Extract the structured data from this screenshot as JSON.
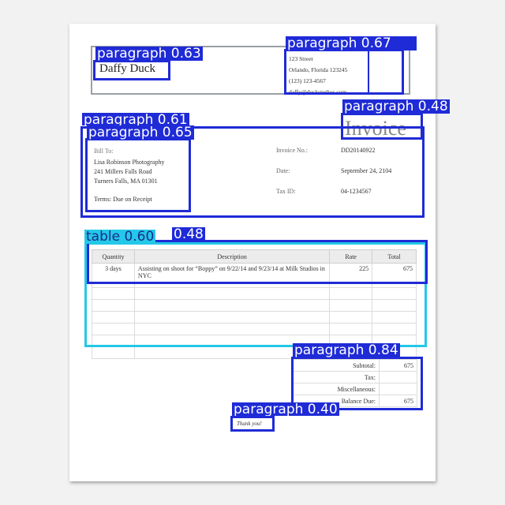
{
  "company": {
    "name": "Daffy Duck"
  },
  "address": {
    "street": "123 Street",
    "city": "Orlando, Florida  123245",
    "phone": "(123) 123-4567",
    "email": "daffy@duckstudios.com"
  },
  "invoice_title": "Invoice",
  "bill_to": {
    "label": "Bill To:",
    "name": "Lisa Robinson Photography",
    "street": "241 Millers Falls Road",
    "city": "Turners Falls, MA  01301",
    "terms": "Terms:  Due on Receipt"
  },
  "meta": [
    {
      "label": "Invoice No.:",
      "value": "DD20140922"
    },
    {
      "label": "Date:",
      "value": "September 24, 2104"
    },
    {
      "label": "Tax ID:",
      "value": "04-1234567"
    }
  ],
  "items_table": {
    "headers": [
      "Quantity",
      "Description",
      "Rate",
      "Total"
    ],
    "rows": [
      [
        "3 days",
        "Assisting on shoot for “Boppy” on 9/22/14 and 9/23/14 at Milk Studios in NYC",
        "225",
        "675"
      ]
    ]
  },
  "totals": [
    {
      "label": "Subtotal:",
      "value": "675"
    },
    {
      "label": "Tax:",
      "value": ""
    },
    {
      "label": "Miscellaneous:",
      "value": ""
    },
    {
      "label": "Balance Due:",
      "value": "675"
    }
  ],
  "thanks": "Thank you!",
  "detections": [
    {
      "label": "paragraph 0.63"
    },
    {
      "label": "paragraph 0.67"
    },
    {
      "label": "paragraph 0.48"
    },
    {
      "label": "paragraph 0.61"
    },
    {
      "label": "paragraph 0.65"
    },
    {
      "label": "table 0.60"
    },
    {
      "label": "0.48"
    },
    {
      "label": "paragraph 0.84"
    },
    {
      "label": "paragraph 0.40"
    }
  ],
  "colors": {
    "detection_box": "#1f2bd6",
    "table_box": "#24c8e8"
  }
}
